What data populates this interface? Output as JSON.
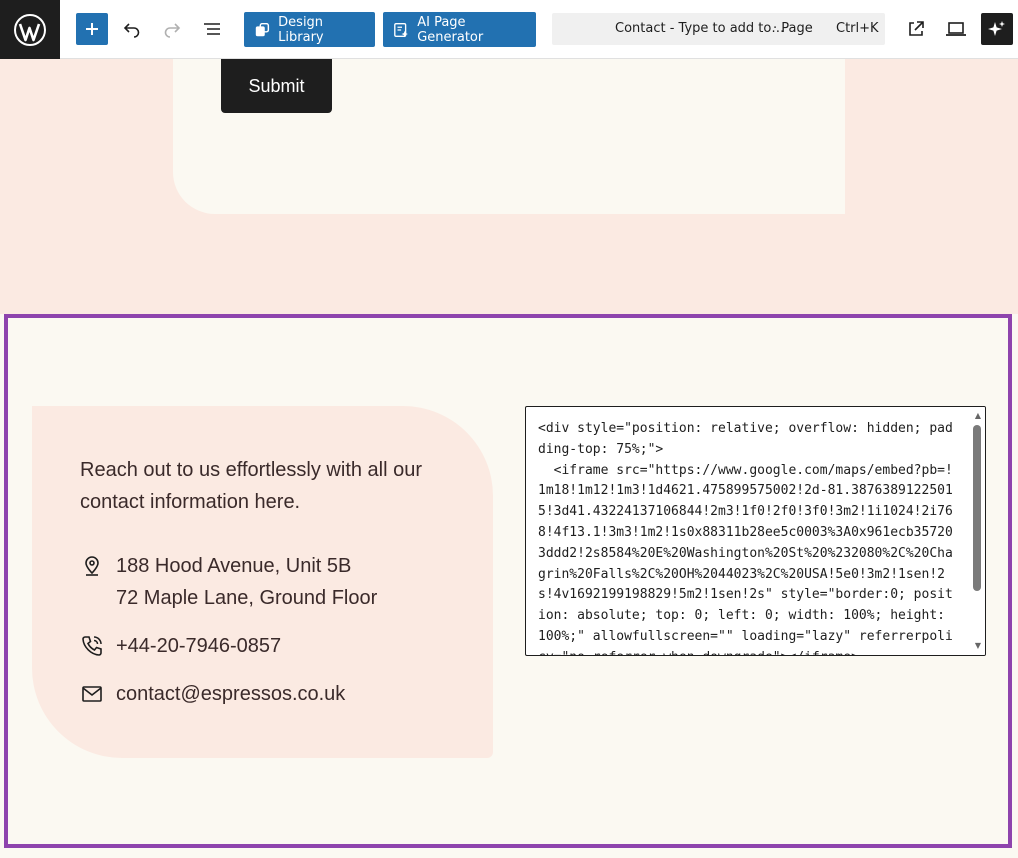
{
  "toolbar": {
    "design_library_label": "Design Library",
    "ai_generator_label": "AI Page Generator",
    "command_title": "Contact - Type to add to…",
    "command_type": "· Page",
    "command_shortcut": "Ctrl+K"
  },
  "form": {
    "submit_label": "Submit"
  },
  "contact": {
    "intro": "Reach out to us effortlessly with all our contact information here.",
    "address_line_1": "188 Hood Avenue, Unit 5B",
    "address_line_2": "72 Maple Lane, Ground Floor",
    "phone": "+44-20-7946-0857",
    "email": "contact@espressos.co.uk"
  },
  "code": {
    "content": "<div style=\"position: relative; overflow: hidden; padding-top: 75%;\">\n  <iframe src=\"https://www.google.com/maps/embed?pb=!1m18!1m12!1m3!1d4621.475899575002!2d-81.38763891225015!3d41.43224137106844!2m3!1f0!2f0!3f0!3m2!1i1024!2i768!4f13.1!3m3!1m2!1s0x88311b28ee5c0003%3A0x961ecb357203ddd2!2s8584%20E%20Washington%20St%20%232080%2C%20Chagrin%20Falls%2C%20OH%2044023%2C%20USA!5e0!3m2!1sen!2s!4v1692199198829!5m2!1sen!2s\" style=\"border:0; position: absolute; top: 0; left: 0; width: 100%; height: 100%;\" allowfullscreen=\"\" loading=\"lazy\" referrerpolicy=\"no-referrer-when-downgrade\"></iframe>\n</div>"
  },
  "colors": {
    "accent_blue": "#2271b1",
    "selection_purple": "#8e44ad",
    "peach_background": "#fbeae2",
    "cream_background": "#fbf9f2"
  },
  "icons": [
    "wordpress-logo",
    "plus-icon",
    "undo-icon",
    "redo-icon",
    "list-view-icon",
    "design-library-icon",
    "ai-generator-icon",
    "external-link-icon",
    "desktop-icon",
    "sparkle-icon",
    "location-pin-icon",
    "phone-icon",
    "mail-icon"
  ]
}
